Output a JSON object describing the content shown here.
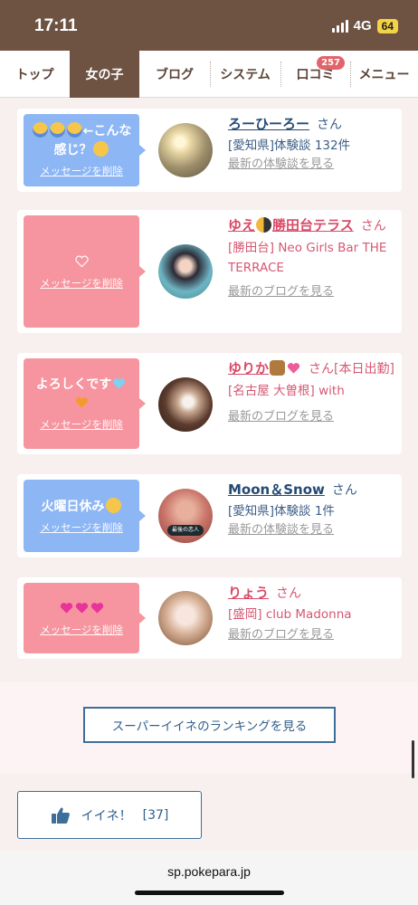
{
  "status": {
    "time": "17:11",
    "network": "4G",
    "battery": "64"
  },
  "tabs": [
    {
      "label": "トップ"
    },
    {
      "label": "女の子"
    },
    {
      "label": "ブログ"
    },
    {
      "label": "システム"
    },
    {
      "label": "口コミ",
      "badge": "257"
    },
    {
      "label": "メニュー"
    }
  ],
  "cards": [
    {
      "message": "こんな感じ？",
      "delete": "メッセージを削除",
      "name": "ろーひーろー",
      "san": "さん",
      "shop": "[愛知県]体験談 132件",
      "more": "最新の体験談を見る"
    },
    {
      "message": "",
      "delete": "メッセージを削除",
      "name": "ゆえ",
      "name2": "勝田台テラス",
      "san": "さん",
      "shop": "[勝田台] Neo Girls Bar THE TERRACE",
      "more": "最新のブログを見る"
    },
    {
      "message": "よろしくです",
      "delete": "メッセージを削除",
      "name": "ゆりか",
      "san": "さん[本日出勤]",
      "shop": "[名古屋 大曽根] with",
      "more": "最新のブログを見る"
    },
    {
      "message": "火曜日休み",
      "delete": "メッセージを削除",
      "name": "Moon＆Snow",
      "san": "さん",
      "shop": "[愛知県]体験談 1件",
      "more": "最新の体験談を見る",
      "avatar_label": "最後の恋人"
    },
    {
      "message": "",
      "delete": "メッセージを削除",
      "name": "りょう",
      "san": "さん",
      "shop": "[盛岡] club Madonna",
      "more": "最新のブログを見る"
    }
  ],
  "ranking_button": "スーパーイイネのランキングを見る",
  "like_button": {
    "label": "イイネ！",
    "count": "[37]"
  },
  "url": "sp.pokepara.jp",
  "colors": {
    "header": "#6e5343",
    "blue_bubble": "#8db6f5",
    "pink_bubble": "#f6959f",
    "link_blue": "#244a74",
    "link_pink": "#d94a68",
    "badge": "#e2646a"
  },
  "icons": {
    "like": "thumbs-up-icon",
    "heart": "heart-icon",
    "face": "emoji-face-icon"
  }
}
